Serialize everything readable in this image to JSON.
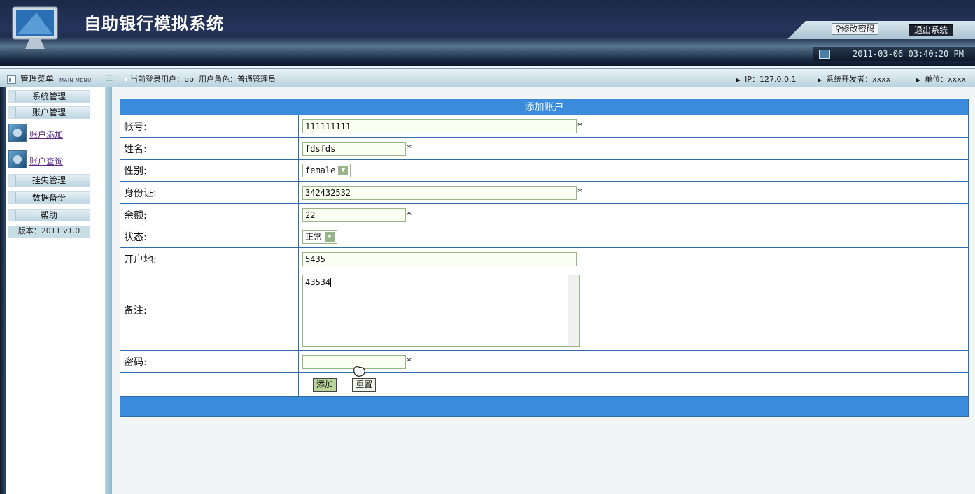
{
  "app": {
    "title": "自助银行模拟系统"
  },
  "header": {
    "change_password": "修改密码",
    "logout": "退出系统",
    "datetime": "2011-03-06 03:40:20 PM"
  },
  "statusbar": {
    "menu_title": "管理菜单",
    "menu_title_en": "MAIN MENU",
    "user_label": "当前登录用户：bb",
    "role_label": "用户角色：普通管理员",
    "ip": "IP：127.0.0.1",
    "developer": "系统开发者：xxxx",
    "unit": "单位：xxxx"
  },
  "sidebar": {
    "sections": [
      "系统管理",
      "账户管理",
      "挂失管理",
      "数据备份",
      "帮助"
    ],
    "links": [
      "账户添加",
      "账户查询"
    ],
    "version": "版本：2011 v1.0"
  },
  "form": {
    "title": "添加账户",
    "required_mark": "*",
    "fields": {
      "account": {
        "label": "帐号:",
        "value": "111111111"
      },
      "name": {
        "label": "姓名:",
        "value": "fdsfds"
      },
      "gender": {
        "label": "性别:",
        "value": "female"
      },
      "id_card": {
        "label": "身份证:",
        "value": "342432532"
      },
      "balance": {
        "label": "余额:",
        "value": "22"
      },
      "status": {
        "label": "状态:",
        "value": "正常"
      },
      "open_place": {
        "label": "开户地:",
        "value": "5435"
      },
      "remark": {
        "label": "备注:",
        "value": "43534"
      },
      "password": {
        "label": "密码:",
        "value": ""
      }
    },
    "submit": "添加",
    "reset": "重置"
  }
}
